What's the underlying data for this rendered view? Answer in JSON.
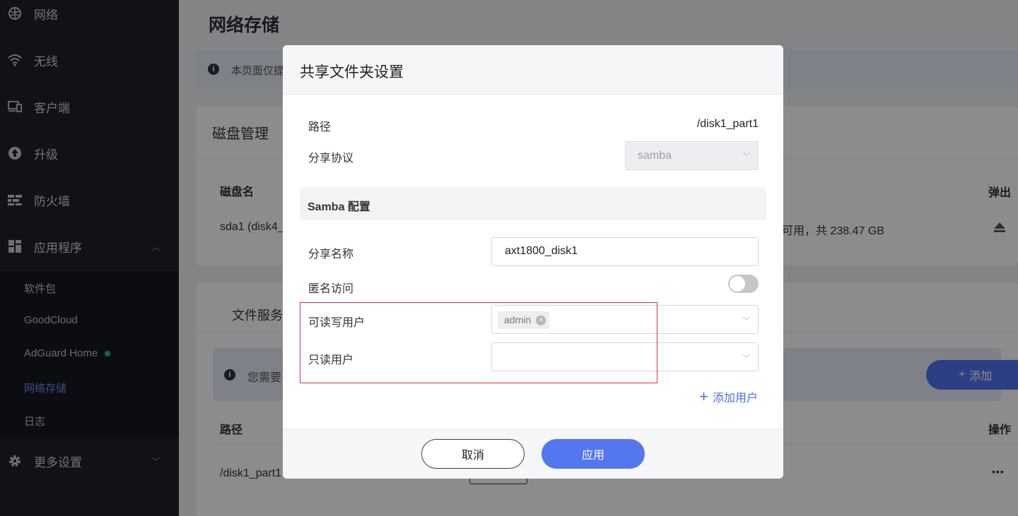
{
  "sidebar": {
    "items": [
      {
        "label": "网络",
        "icon": "globe-icon"
      },
      {
        "label": "无线",
        "icon": "wifi-icon"
      },
      {
        "label": "客户端",
        "icon": "devices-icon"
      },
      {
        "label": "升级",
        "icon": "upgrade-icon"
      },
      {
        "label": "防火墙",
        "icon": "firewall-icon"
      },
      {
        "label": "应用程序",
        "icon": "apps-icon"
      },
      {
        "label": "更多设置",
        "icon": "gear-icon"
      }
    ],
    "subitems": [
      {
        "label": "软件包"
      },
      {
        "label": "GoodCloud"
      },
      {
        "label": "AdGuard Home"
      },
      {
        "label": "网络存储"
      },
      {
        "label": "日志"
      }
    ]
  },
  "page": {
    "title": "网络存储",
    "info_text": "本页面仅提",
    "disk_card_title": "磁盘管理",
    "disk_col_name": "磁盘名",
    "disk_col_eject": "弹出",
    "disk_row_name": "sda1 (disk4_",
    "disk_row_space": "可用，共 238.47 GB",
    "file_service_title": "文件服务",
    "file_info_text": "您需要",
    "add_label": "添加",
    "file_col_path": "路径",
    "file_col_ops": "操作",
    "file_row_path": "/disk1_part1",
    "file_row_ops": "•••"
  },
  "modal": {
    "title": "共享文件夹设置",
    "path_label": "路径",
    "path_value": "/disk1_part1",
    "protocol_label": "分享协议",
    "protocol_value": "samba",
    "section_title": "Samba 配置",
    "share_name_label": "分享名称",
    "share_name_value": "axt1800_disk1",
    "anonymous_label": "匿名访问",
    "anonymous_enabled": false,
    "rw_users_label": "可读写用户",
    "rw_users": [
      "admin"
    ],
    "ro_users_label": "只读用户",
    "add_user_label": "添加用户",
    "cancel_label": "取消",
    "apply_label": "应用"
  },
  "colors": {
    "accent": "#5476ee",
    "highlight_border": "#e0323a",
    "sidebar_bg": "#1e222c"
  }
}
